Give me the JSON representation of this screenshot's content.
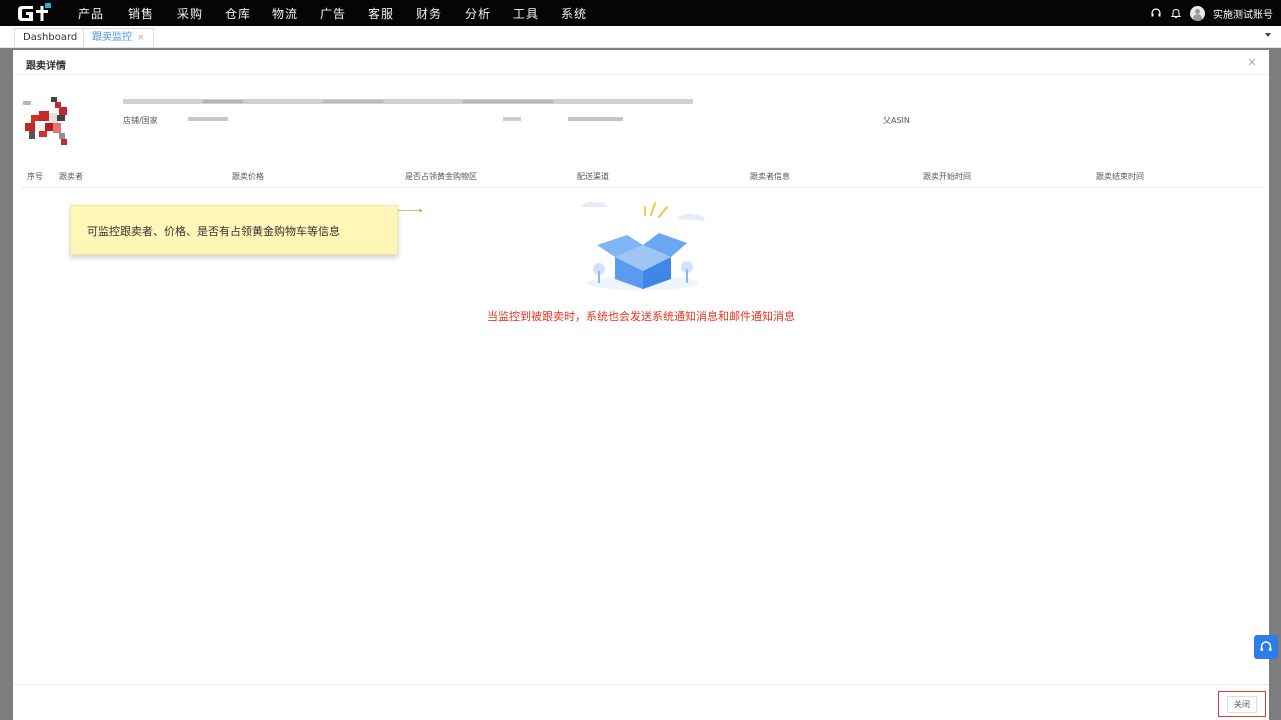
{
  "nav": {
    "items": [
      "产品",
      "销售",
      "采购",
      "仓库",
      "物流",
      "广告",
      "客服",
      "财务",
      "分析",
      "工具",
      "系统"
    ],
    "user_name": "实施测试账号"
  },
  "tabs": {
    "dashboard": "Dashboard",
    "active": "跟卖监控",
    "close_glyph": "×"
  },
  "dialog": {
    "title": "跟卖详情",
    "close_glyph": "×",
    "store_country_label": "店铺/国家",
    "parent_asin_label": "父ASIN",
    "columns": [
      "序号",
      "跟卖者",
      "跟卖价格",
      "是否占领黄金购物区",
      "配送渠道",
      "跟卖者信息",
      "跟卖开始时间",
      "跟卖结束时间"
    ],
    "empty_message": "当监控到被跟卖时，系统也会发送系统通知消息和邮件通知消息",
    "close_button": "关闭"
  },
  "tooltip": {
    "text": "可监控跟卖者、价格、是否有占领黄金购物车等信息"
  },
  "colors": {
    "accent": "#2b7de9",
    "warning_text": "#e8341c",
    "tooltip_bg": "#fff6b8",
    "topbar_bg": "#050505"
  }
}
